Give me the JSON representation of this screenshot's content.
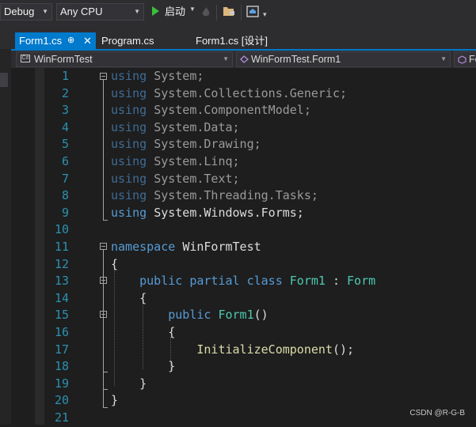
{
  "toolbar": {
    "config": "Debug",
    "platform": "Any CPU",
    "start_label": "启动"
  },
  "tabs": [
    {
      "label": "Form1.cs",
      "pin": "⊕",
      "close": "✕"
    },
    {
      "label": "Program.cs"
    },
    {
      "label": "Form1.cs [设计]"
    }
  ],
  "nav": {
    "project": "WinFormTest",
    "class": "WinFormTest.Form1",
    "member_partial": "Fo",
    "project_icon": "C#"
  },
  "code_lines": [
    {
      "n": "1"
    },
    {
      "n": "2"
    },
    {
      "n": "3"
    },
    {
      "n": "4"
    },
    {
      "n": "5"
    },
    {
      "n": "6"
    },
    {
      "n": "7"
    },
    {
      "n": "8"
    },
    {
      "n": "9"
    },
    {
      "n": "10"
    },
    {
      "n": "11"
    },
    {
      "n": "12"
    },
    {
      "n": "13"
    },
    {
      "n": "14"
    },
    {
      "n": "15"
    },
    {
      "n": "16"
    },
    {
      "n": "17"
    },
    {
      "n": "18"
    },
    {
      "n": "19"
    },
    {
      "n": "20"
    },
    {
      "n": "21"
    }
  ],
  "code": {
    "using": "using",
    "ns1": "System;",
    "ns2": "System.Collections.Generic;",
    "ns3": "System.ComponentModel;",
    "ns4": "System.Data;",
    "ns5": "System.Drawing;",
    "ns6": "System.Linq;",
    "ns7": "System.Text;",
    "ns8": "System.Threading.Tasks;",
    "ns9": "System.Windows.Forms;",
    "namespace_kw": "namespace",
    "namespace_name": "WinFormTest",
    "open_brace": "{",
    "close_brace": "}",
    "public_kw": "public",
    "partial_kw": "partial",
    "class_kw": "class",
    "class_name": "Form1",
    "colon": ":",
    "base_class": "Form",
    "ctor_name": "Form1",
    "parens": "()",
    "init_call": "InitializeComponent",
    "init_tail": "();"
  },
  "watermark": "CSDN @R-G-B",
  "colors": {
    "accent": "#007acc",
    "keyword": "#569cd6",
    "type": "#4ec9b0",
    "method": "#dcdcaa",
    "line_number": "#2b91af"
  }
}
